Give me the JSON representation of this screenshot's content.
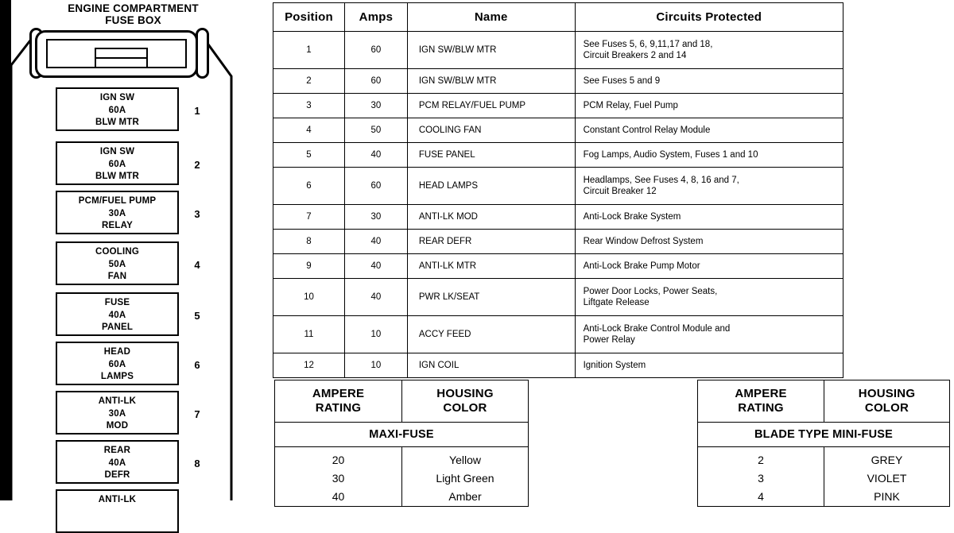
{
  "diagram": {
    "title_line1": "ENGINE COMPARTMENT",
    "title_line2": "FUSE BOX",
    "fuses": [
      {
        "line1": "IGN SW",
        "amps": "60A",
        "line3": "BLW MTR",
        "index": "1"
      },
      {
        "line1": "IGN SW",
        "amps": "60A",
        "line3": "BLW MTR",
        "index": "2"
      },
      {
        "line1": "PCM/FUEL PUMP",
        "amps": "30A",
        "line3": "RELAY",
        "index": "3"
      },
      {
        "line1": "COOLING",
        "amps": "50A",
        "line3": "FAN",
        "index": "4"
      },
      {
        "line1": "FUSE",
        "amps": "40A",
        "line3": "PANEL",
        "index": "5"
      },
      {
        "line1": "HEAD",
        "amps": "60A",
        "line3": "LAMPS",
        "index": "6"
      },
      {
        "line1": "ANTI-LK",
        "amps": "30A",
        "line3": "MOD",
        "index": "7"
      },
      {
        "line1": "REAR",
        "amps": "40A",
        "line3": "DEFR",
        "index": "8"
      },
      {
        "line1": "ANTI-LK",
        "amps": "",
        "line3": "",
        "index": ""
      }
    ]
  },
  "main_table": {
    "headers": [
      "Position",
      "Amps",
      "Name",
      "Circuits Protected"
    ],
    "rows": [
      {
        "position": "1",
        "amps": "60",
        "name": "IGN SW/BLW MTR",
        "circuits": "See Fuses 5, 6, 9,11,17 and 18,\nCircuit Breakers 2 and 14"
      },
      {
        "position": "2",
        "amps": "60",
        "name": "IGN SW/BLW MTR",
        "circuits": "See Fuses 5 and 9"
      },
      {
        "position": "3",
        "amps": "30",
        "name": "PCM RELAY/FUEL PUMP",
        "circuits": "PCM Relay, Fuel Pump"
      },
      {
        "position": "4",
        "amps": "50",
        "name": "COOLING FAN",
        "circuits": "Constant Control Relay Module"
      },
      {
        "position": "5",
        "amps": "40",
        "name": "FUSE PANEL",
        "circuits": "Fog Lamps, Audio System, Fuses 1 and 10"
      },
      {
        "position": "6",
        "amps": "60",
        "name": "HEAD LAMPS",
        "circuits": "Headlamps, See Fuses 4, 8, 16 and 7,\nCircuit Breaker 12"
      },
      {
        "position": "7",
        "amps": "30",
        "name": "ANTI-LK MOD",
        "circuits": "Anti-Lock Brake System"
      },
      {
        "position": "8",
        "amps": "40",
        "name": "REAR DEFR",
        "circuits": "Rear Window Defrost System"
      },
      {
        "position": "9",
        "amps": "40",
        "name": "ANTI-LK MTR",
        "circuits": "Anti-Lock Brake Pump Motor"
      },
      {
        "position": "10",
        "amps": "40",
        "name": "PWR LK/SEAT",
        "circuits": "Power Door Locks, Power Seats,\nLiftgate Release"
      },
      {
        "position": "11",
        "amps": "10",
        "name": "ACCY FEED",
        "circuits": "Anti-Lock Brake Control Module and\nPower Relay"
      },
      {
        "position": "12",
        "amps": "10",
        "name": "IGN COIL",
        "circuits": "Ignition System"
      }
    ]
  },
  "maxi_fuse_table": {
    "header_col1_line1": "AMPERE",
    "header_col1_line2": "RATING",
    "header_col2_line1": "HOUSING",
    "header_col2_line2": "COLOR",
    "subhead": "MAXI-FUSE",
    "ratings": "20\n30\n40",
    "colors": "Yellow\nLight Green\nAmber"
  },
  "mini_fuse_table": {
    "header_col1_line1": "AMPERE",
    "header_col1_line2": "RATING",
    "header_col2_line1": "HOUSING",
    "header_col2_line2": "COLOR",
    "subhead": "BLADE TYPE MINI-FUSE",
    "ratings": "2\n3\n4",
    "colors": "GREY\nVIOLET\nPINK"
  }
}
